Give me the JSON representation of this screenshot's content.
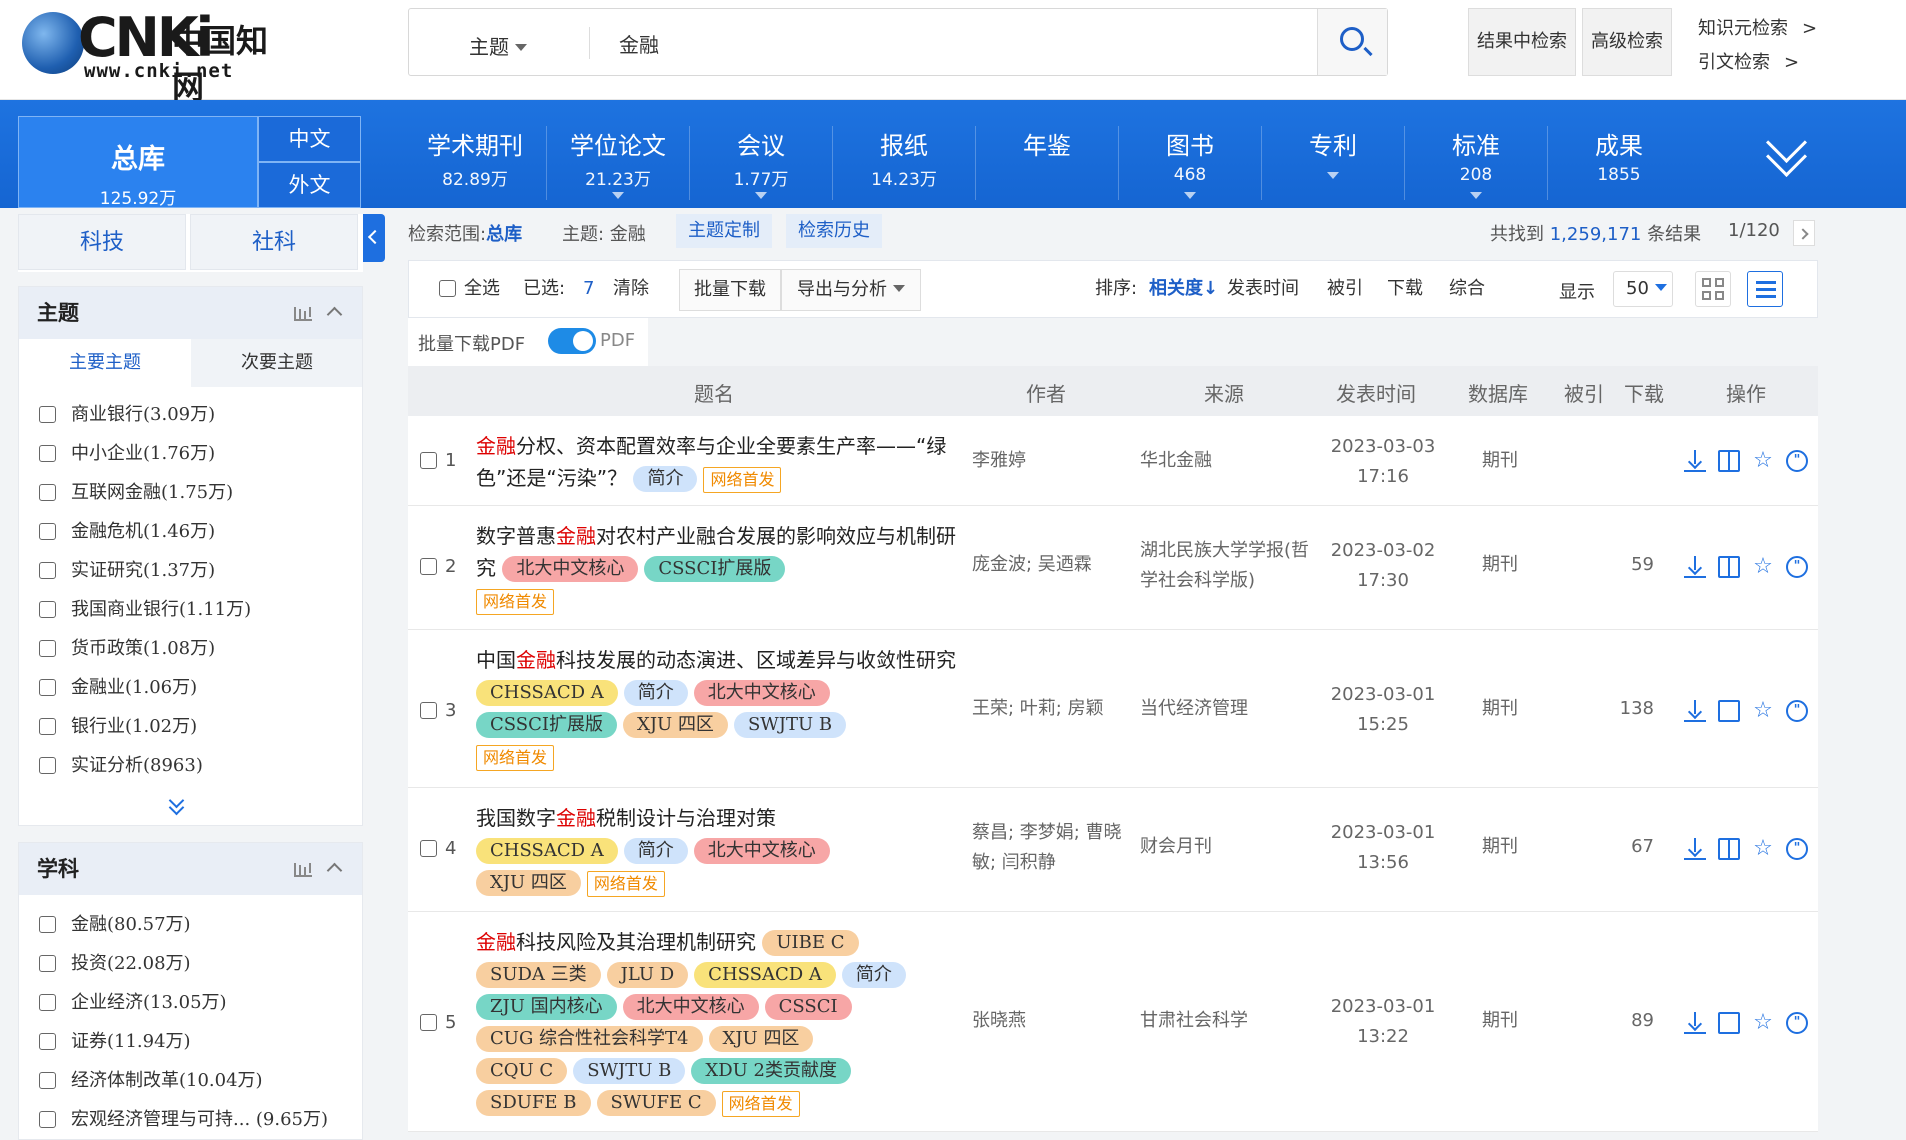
{
  "header": {
    "logo_text_nk": "CNKi",
    "logo_text_cn": "中国知网",
    "logo_url": "www.cnki.net",
    "search_scope": "主题",
    "search_query": "金融",
    "btn_in_results": "结果中检索",
    "btn_advanced": "高级检索",
    "link_knowledge": "知识元检索",
    "link_citation": "引文检索",
    "arrow": ">"
  },
  "nav": {
    "zongku": {
      "label": "总库",
      "count": "125.92万"
    },
    "lang_cn": "中文",
    "lang_foreign": "外文",
    "items": [
      {
        "label": "学术期刊",
        "count": "82.89万"
      },
      {
        "label": "学位论文",
        "count": "21.23万"
      },
      {
        "label": "会议",
        "count": "1.77万"
      },
      {
        "label": "报纸",
        "count": "14.23万"
      },
      {
        "label": "年鉴",
        "count": ""
      },
      {
        "label": "图书",
        "count": "468"
      },
      {
        "label": "专利",
        "count": ""
      },
      {
        "label": "标准",
        "count": "208"
      },
      {
        "label": "成果",
        "count": "1855"
      }
    ]
  },
  "sidebar": {
    "tab_tech": "科技",
    "tab_social": "社科",
    "topic_panel": {
      "title": "主题",
      "tab_main": "主要主题",
      "tab_sub": "次要主题",
      "items": [
        "商业银行(3.09万)",
        "中小企业(1.76万)",
        "互联网金融(1.75万)",
        "金融危机(1.46万)",
        "实证研究(1.37万)",
        "我国商业银行(1.11万)",
        "货币政策(1.08万)",
        "金融业(1.06万)",
        "银行业(1.02万)",
        "实证分析(8963)"
      ]
    },
    "subject_panel": {
      "title": "学科",
      "items": [
        "金融(80.57万)",
        "投资(22.08万)",
        "企业经济(13.05万)",
        "证券(11.94万)",
        "经济体制改革(10.04万)",
        "宏观经济管理与可持...  (9.65万)"
      ]
    }
  },
  "main": {
    "scope_label": "检索范围:",
    "scope_value": "总库",
    "topic_label": "主题: 金融",
    "chip_custom": "主题定制",
    "chip_history": "检索历史",
    "total_prefix": "共找到",
    "total_num": "1,259,171",
    "total_suffix": "条结果",
    "pager": "1/120",
    "toolbar": {
      "select_all": "全选",
      "selected_label": "已选:",
      "selected_count": "7",
      "clear": "清除",
      "batch_download": "批量下载",
      "export": "导出与分析",
      "sort_label": "排序:",
      "sort_relevance": "相关度",
      "sort_relevance_arrow": "↓",
      "sort_time": "发表时间",
      "sort_cited": "被引",
      "sort_download": "下载",
      "sort_overall": "综合",
      "display_label": "显示",
      "display_value": "50"
    },
    "pdf": {
      "label": "批量下载PDF",
      "toggle_text": "PDF"
    },
    "table_headers": {
      "title": "题名",
      "author": "作者",
      "source": "来源",
      "date": "发表时间",
      "db": "数据库",
      "cited": "被引",
      "download": "下载",
      "ops": "操作"
    },
    "rows": [
      {
        "no": "1",
        "title_hl": "金融",
        "title_rest": "分权、资本配置效率与企业全要素生产率——“绿色”还是“污染”？",
        "tags": [
          "简介"
        ],
        "first": "网络首发",
        "author": "李雅婷",
        "source": "华北金融",
        "date": "2023-03-03",
        "time": "17:16",
        "db": "期刊",
        "cited": "",
        "download": ""
      },
      {
        "no": "2",
        "title_pre": "数字普惠",
        "title_hl": "金融",
        "title_rest": "对农村产业融合发展的影响效应与机制研究",
        "tags": [
          "北大中文核心",
          "CSSCI扩展版"
        ],
        "first": "网络首发",
        "author": "庞金波; 吴迺霖",
        "source": "湖北民族大学学报(哲学社会科学版)",
        "date": "2023-03-02",
        "time": "17:30",
        "db": "期刊",
        "cited": "",
        "download": "59"
      },
      {
        "no": "3",
        "title_pre": "中国",
        "title_hl": "金融",
        "title_rest": "科技发展的动态演进、区域差异与收敛性研究",
        "tags": [
          "CHSSACD A",
          "简介",
          "北大中文核心",
          "CSSCI扩展版",
          "XJU 四区",
          "SWJTU B"
        ],
        "first": "网络首发",
        "author": "王荣; 叶莉; 房颖",
        "source": "当代经济管理",
        "date": "2023-03-01",
        "time": "15:25",
        "db": "期刊",
        "cited": "",
        "download": "138"
      },
      {
        "no": "4",
        "title_pre": "我国数字",
        "title_hl": "金融",
        "title_rest": "税制设计与治理对策",
        "tags": [
          "CHSSACD A",
          "简介",
          "北大中文核心",
          "XJU 四区"
        ],
        "first": "网络首发",
        "author": "蔡昌; 李梦娟; 曹晓敏; 闫积静",
        "source": "财会月刊",
        "date": "2023-03-01",
        "time": "13:56",
        "db": "期刊",
        "cited": "",
        "download": "67"
      },
      {
        "no": "5",
        "title_hl": "金融",
        "title_rest": "科技风险及其治理机制研究",
        "tags": [
          "UIBE C",
          "SUDA 三类",
          "JLU D",
          "CHSSACD A",
          "简介",
          "ZJU 国内核心",
          "北大中文核心",
          "CSSCI",
          "CUG 综合性社会科学T4",
          "XJU 四区",
          "CQU C",
          "SWJTU B",
          "XDU 2类贡献度",
          "SDUFE B",
          "SWUFE C"
        ],
        "first": "网络首发",
        "author": "张晓燕",
        "source": "甘肃社会科学",
        "date": "2023-03-01",
        "time": "13:22",
        "db": "期刊",
        "cited": "",
        "download": "89"
      }
    ]
  },
  "colors": {
    "accent": "#1e6fe0",
    "highlight": "#dd0000",
    "nav_blue": "#1565d2"
  }
}
